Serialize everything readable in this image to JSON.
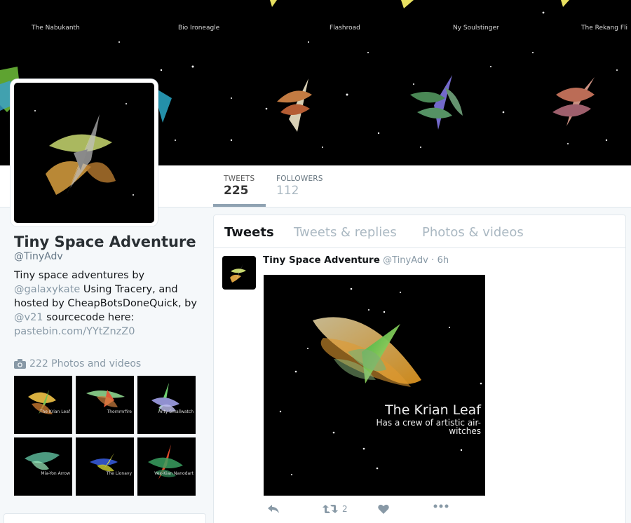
{
  "banner": {
    "ship_names": [
      "The Nabukanth",
      "Bio Ironeagle",
      "Flashroad",
      "Ny Soulstinger",
      "The Rekang Fli"
    ]
  },
  "nav": {
    "tweets_label": "TWEETS",
    "tweets_count": "225",
    "followers_label": "FOLLOWERS",
    "followers_count": "112"
  },
  "profile": {
    "name": "Tiny Space Adventure",
    "handle": "@TinyAdv",
    "bio_1": "Tiny space adventures by",
    "bio_link_1": "@galaxykate",
    "bio_2": " Using Tracery, and hosted by CheapBotsDoneQuick, by",
    "bio_link_2": "@v21",
    "bio_3": " sourcecode here:",
    "bio_link_3": "pastebin.com/YYtZnzZ0",
    "photos_label": "222 Photos and videos",
    "photos_icon": "camera-icon",
    "thumb_captions": [
      "The Krian Leaf",
      "Thornmrfire",
      "Anty Smallwatch",
      "Mia-Yon Arrow",
      "The Lionavy",
      "Vex-Kian Nanodart"
    ]
  },
  "timeline": {
    "tabs": [
      "Tweets",
      "Tweets & replies",
      "Photos & videos"
    ],
    "tweet": {
      "name": "Tiny Space Adventure",
      "handle": "@TinyAdv",
      "sep": "·",
      "time": "6h",
      "media_title": "The Krian Leaf",
      "media_subtitle": "Has a crew of artistic air-witches",
      "retweet_count": "2",
      "icons": [
        "reply-icon",
        "retweet-icon",
        "heart-icon",
        "more-icon"
      ]
    }
  },
  "colors": {
    "link": "#8899a6",
    "accent_border": "#8fa2b2",
    "background": "#f5f8fa"
  }
}
